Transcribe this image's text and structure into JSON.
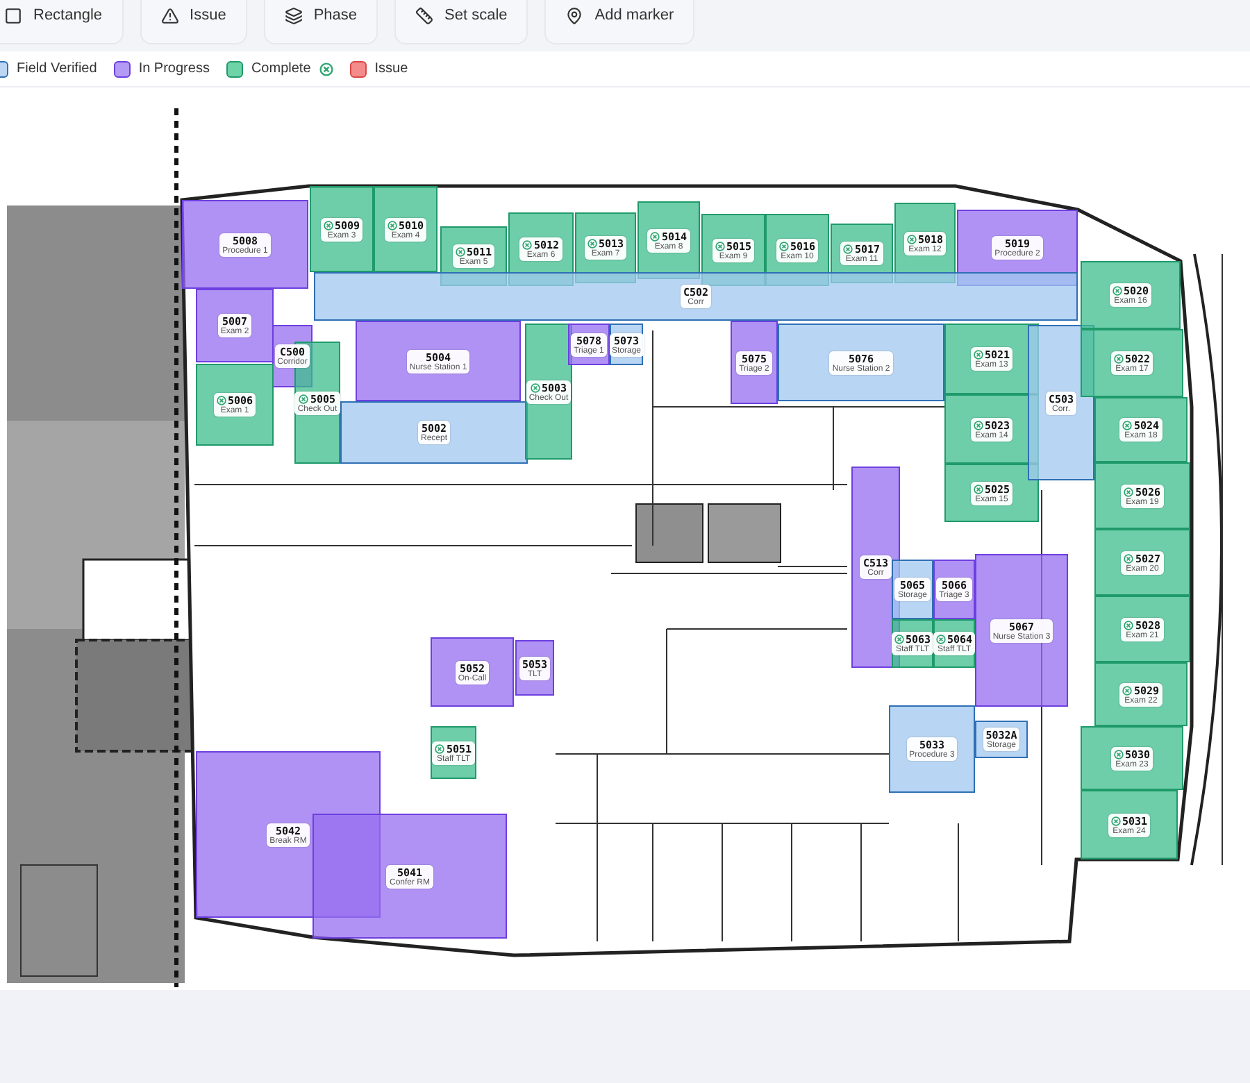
{
  "toolbar": [
    {
      "label": "Rectangle",
      "kind": "rectangle"
    },
    {
      "label": "Issue",
      "kind": "issue"
    },
    {
      "label": "Phase",
      "kind": "phase"
    },
    {
      "label": "Set scale",
      "kind": "scale"
    },
    {
      "label": "Add marker",
      "kind": "marker"
    }
  ],
  "legend": [
    {
      "label": "Field Verified",
      "kind": "verified"
    },
    {
      "label": "In Progress",
      "kind": "in_progress"
    },
    {
      "label": "Complete",
      "kind": "complete"
    },
    {
      "label": "Issue",
      "kind": "issue"
    }
  ],
  "rooms": [
    {
      "number": "5008",
      "name": "Procedure 1",
      "kind": "in_progress"
    },
    {
      "number": "5009",
      "name": "Exam 3",
      "kind": "complete"
    },
    {
      "number": "5010",
      "name": "Exam 4",
      "kind": "complete"
    },
    {
      "number": "5011",
      "name": "Exam 5",
      "kind": "complete"
    },
    {
      "number": "5012",
      "name": "Exam 6",
      "kind": "complete"
    },
    {
      "number": "5013",
      "name": "Exam 7",
      "kind": "complete"
    },
    {
      "number": "5014",
      "name": "Exam 8",
      "kind": "complete"
    },
    {
      "number": "5015",
      "name": "Exam 9",
      "kind": "complete"
    },
    {
      "number": "5016",
      "name": "Exam 10",
      "kind": "complete"
    },
    {
      "number": "5017",
      "name": "Exam 11",
      "kind": "complete"
    },
    {
      "number": "5018",
      "name": "Exam 12",
      "kind": "complete"
    },
    {
      "number": "5019",
      "name": "Procedure 2",
      "kind": "in_progress"
    },
    {
      "number": "C502",
      "name": "Corr",
      "kind": "verified"
    },
    {
      "number": "5007",
      "name": "Exam 2",
      "kind": "in_progress"
    },
    {
      "number": "C500",
      "name": "Corridor",
      "kind": "in_progress"
    },
    {
      "number": "5006",
      "name": "Exam 1",
      "kind": "complete"
    },
    {
      "number": "5005",
      "name": "Check Out",
      "kind": "complete"
    },
    {
      "number": "5004",
      "name": "Nurse Station 1",
      "kind": "in_progress"
    },
    {
      "number": "5002",
      "name": "Recept",
      "kind": "verified"
    },
    {
      "number": "5003",
      "name": "Check Out",
      "kind": "complete"
    },
    {
      "number": "5078",
      "name": "Triage 1",
      "kind": "in_progress"
    },
    {
      "number": "5073",
      "name": "Storage",
      "kind": "verified"
    },
    {
      "number": "5075",
      "name": "Triage 2",
      "kind": "in_progress"
    },
    {
      "number": "5076",
      "name": "Nurse Station 2",
      "kind": "verified"
    },
    {
      "number": "5021",
      "name": "Exam 13",
      "kind": "complete"
    },
    {
      "number": "5023",
      "name": "Exam 14",
      "kind": "complete"
    },
    {
      "number": "5025",
      "name": "Exam 15",
      "kind": "complete"
    },
    {
      "number": "C503",
      "name": "Corr.",
      "kind": "verified"
    },
    {
      "number": "5020",
      "name": "Exam 16",
      "kind": "complete"
    },
    {
      "number": "5022",
      "name": "Exam 17",
      "kind": "complete"
    },
    {
      "number": "5024",
      "name": "Exam 18",
      "kind": "complete"
    },
    {
      "number": "5026",
      "name": "Exam 19",
      "kind": "complete"
    },
    {
      "number": "5027",
      "name": "Exam 20",
      "kind": "complete"
    },
    {
      "number": "5028",
      "name": "Exam 21",
      "kind": "complete"
    },
    {
      "number": "5029",
      "name": "Exam 22",
      "kind": "complete"
    },
    {
      "number": "5030",
      "name": "Exam 23",
      "kind": "complete"
    },
    {
      "number": "5031",
      "name": "Exam 24",
      "kind": "complete"
    },
    {
      "number": "C513",
      "name": "Corr",
      "kind": "in_progress"
    },
    {
      "number": "5065",
      "name": "Storage",
      "kind": "verified"
    },
    {
      "number": "5066",
      "name": "Triage 3",
      "kind": "in_progress"
    },
    {
      "number": "5063",
      "name": "Staff TLT",
      "kind": "complete"
    },
    {
      "number": "5064",
      "name": "Staff TLT",
      "kind": "complete"
    },
    {
      "number": "5067",
      "name": "Nurse Station 3",
      "kind": "in_progress"
    },
    {
      "number": "5033",
      "name": "Procedure 3",
      "kind": "verified"
    },
    {
      "number": "5032A",
      "name": "Storage",
      "kind": "verified"
    },
    {
      "number": "5052",
      "name": "On-Call",
      "kind": "in_progress"
    },
    {
      "number": "5053",
      "name": "TLT",
      "kind": "in_progress"
    },
    {
      "number": "5051",
      "name": "Staff TLT",
      "kind": "complete"
    },
    {
      "number": "5042",
      "name": "Break RM",
      "kind": "in_progress"
    },
    {
      "number": "5041",
      "name": "Confer RM",
      "kind": "in_progress"
    }
  ]
}
